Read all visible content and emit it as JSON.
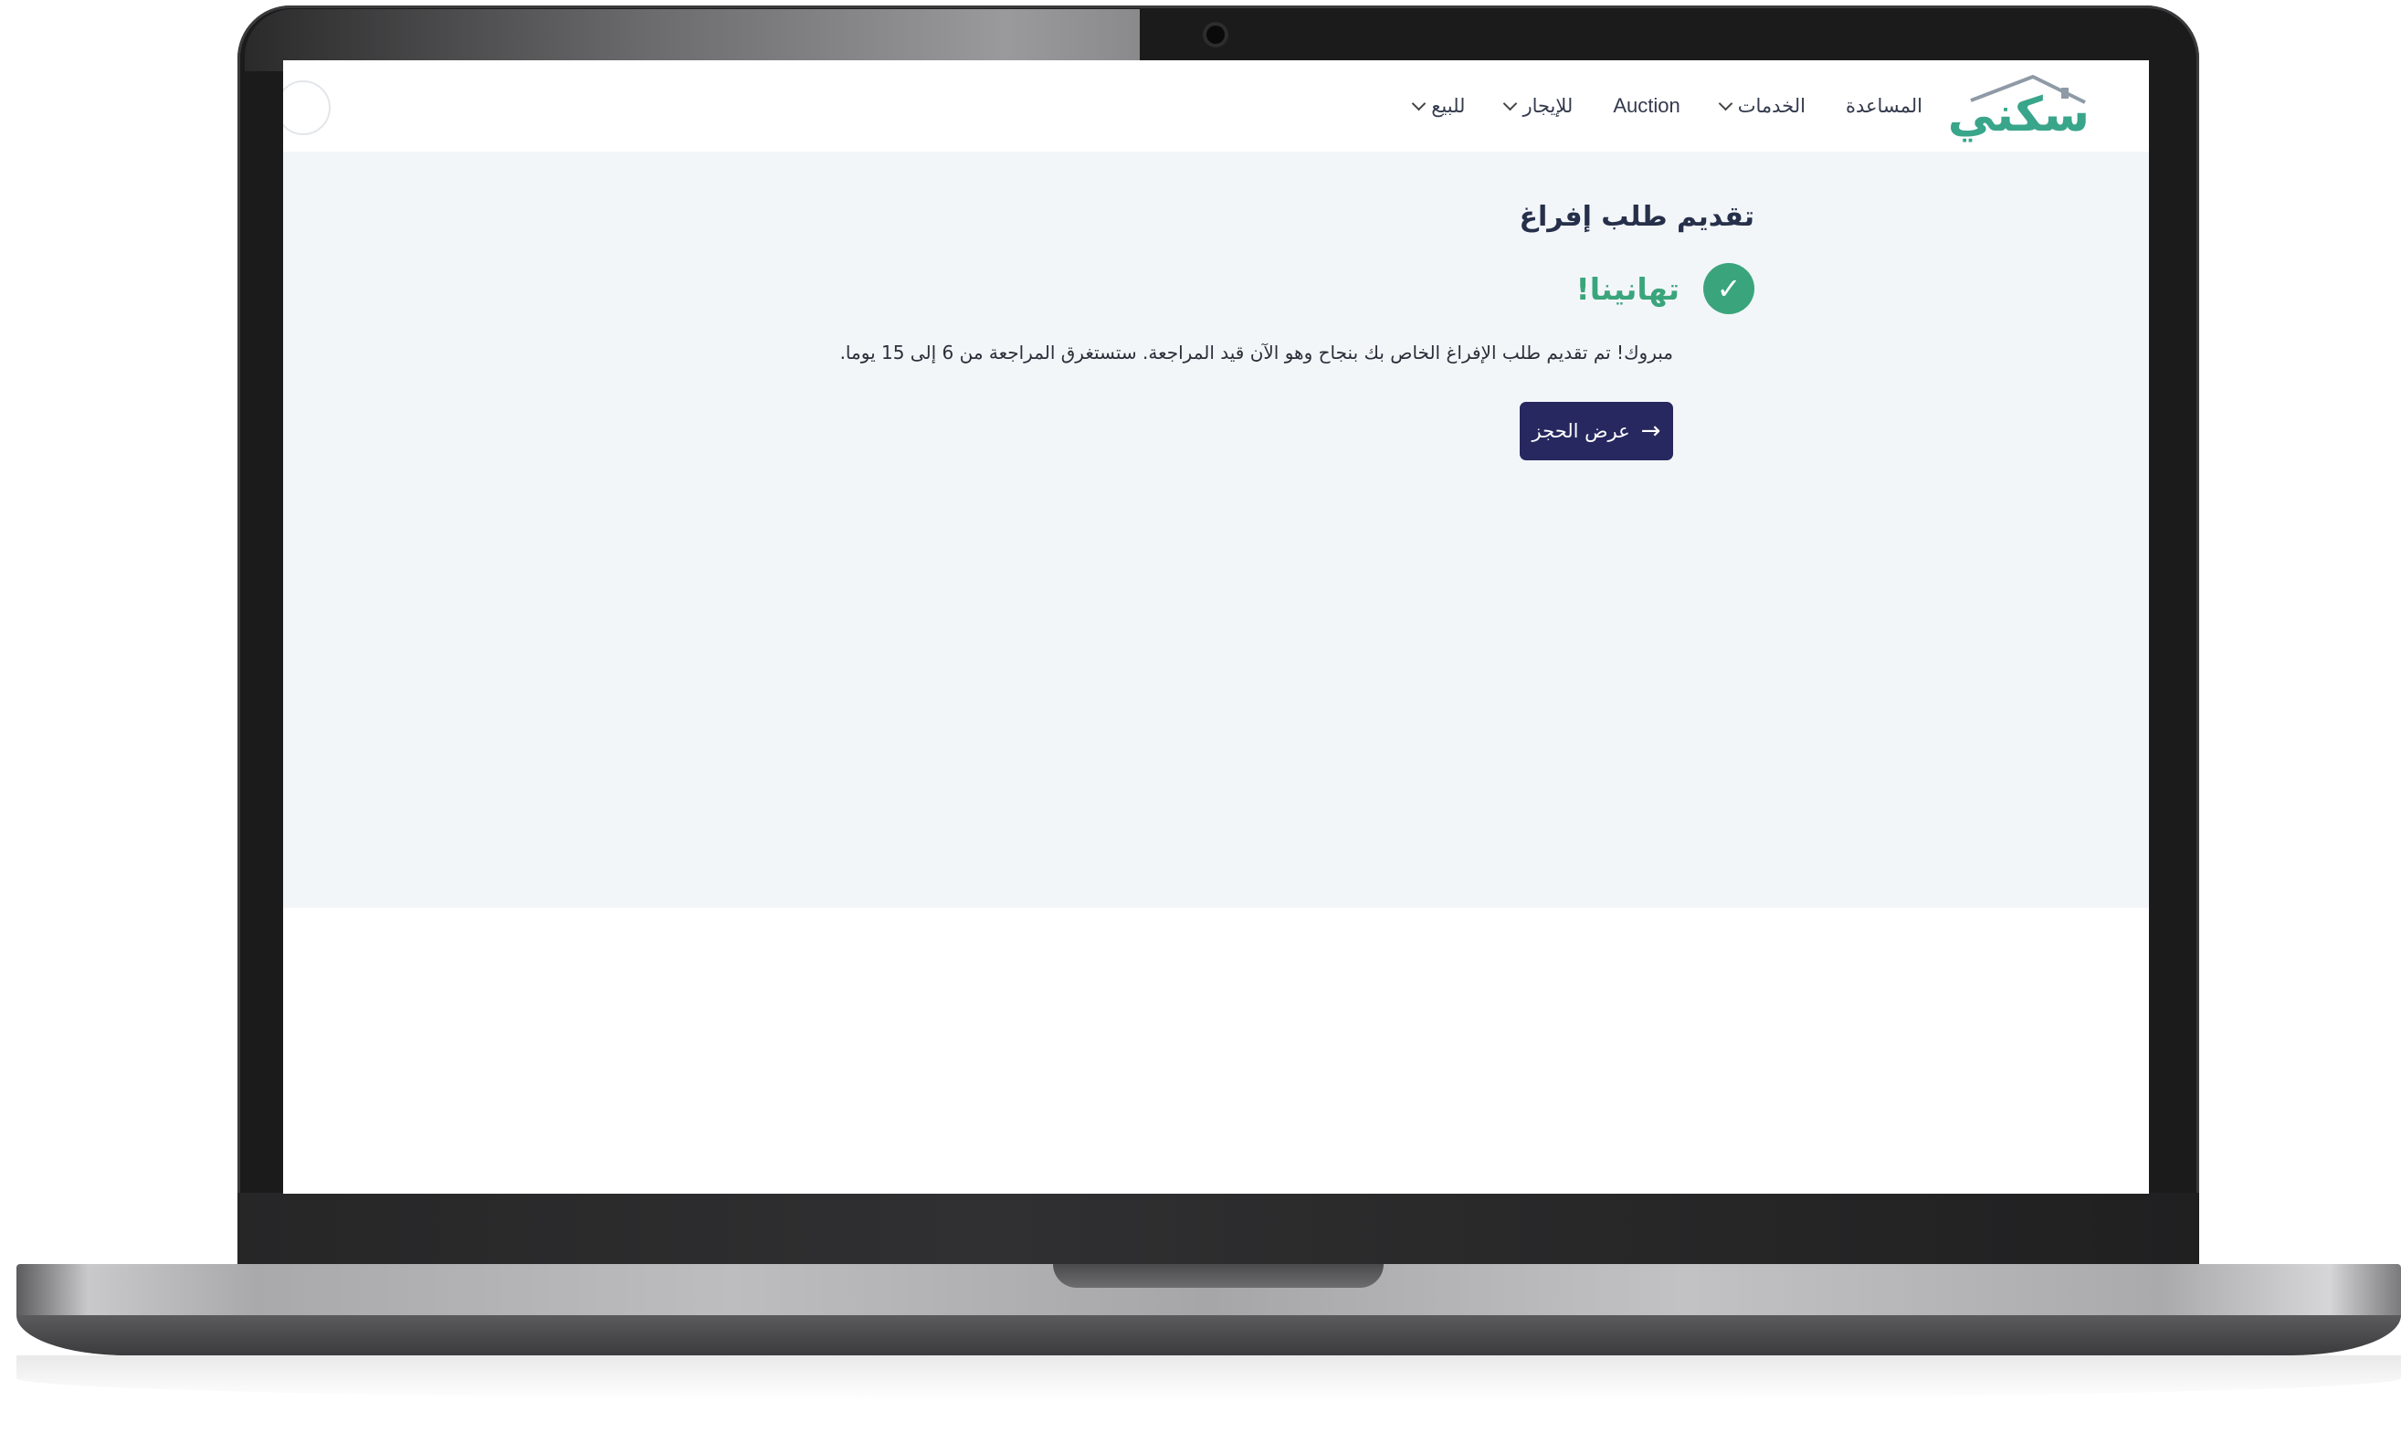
{
  "brand": {
    "logo_text": "سكني",
    "color": "#39a58a"
  },
  "nav": {
    "items": [
      {
        "label": "للبيع",
        "has_dropdown": true
      },
      {
        "label": "للإيجار",
        "has_dropdown": true
      },
      {
        "label": "Auction",
        "has_dropdown": false
      },
      {
        "label": "الخدمات",
        "has_dropdown": true
      },
      {
        "label": "المساعدة",
        "has_dropdown": false
      }
    ]
  },
  "main": {
    "title": "تقديم طلب إفراغ",
    "success": {
      "icon": "check-icon",
      "heading": "تهانينا!",
      "color": "#3aa57c",
      "message": "مبروك! تم تقديم طلب الإفراغ الخاص بك بنجاح وهو الآن قيد المراجعة. ستستغرق المراجعة من 6 إلى 15 يوما."
    },
    "view_button": {
      "label": "عرض الحجز",
      "icon": "arrow-right-icon",
      "color": "#27285f"
    }
  }
}
